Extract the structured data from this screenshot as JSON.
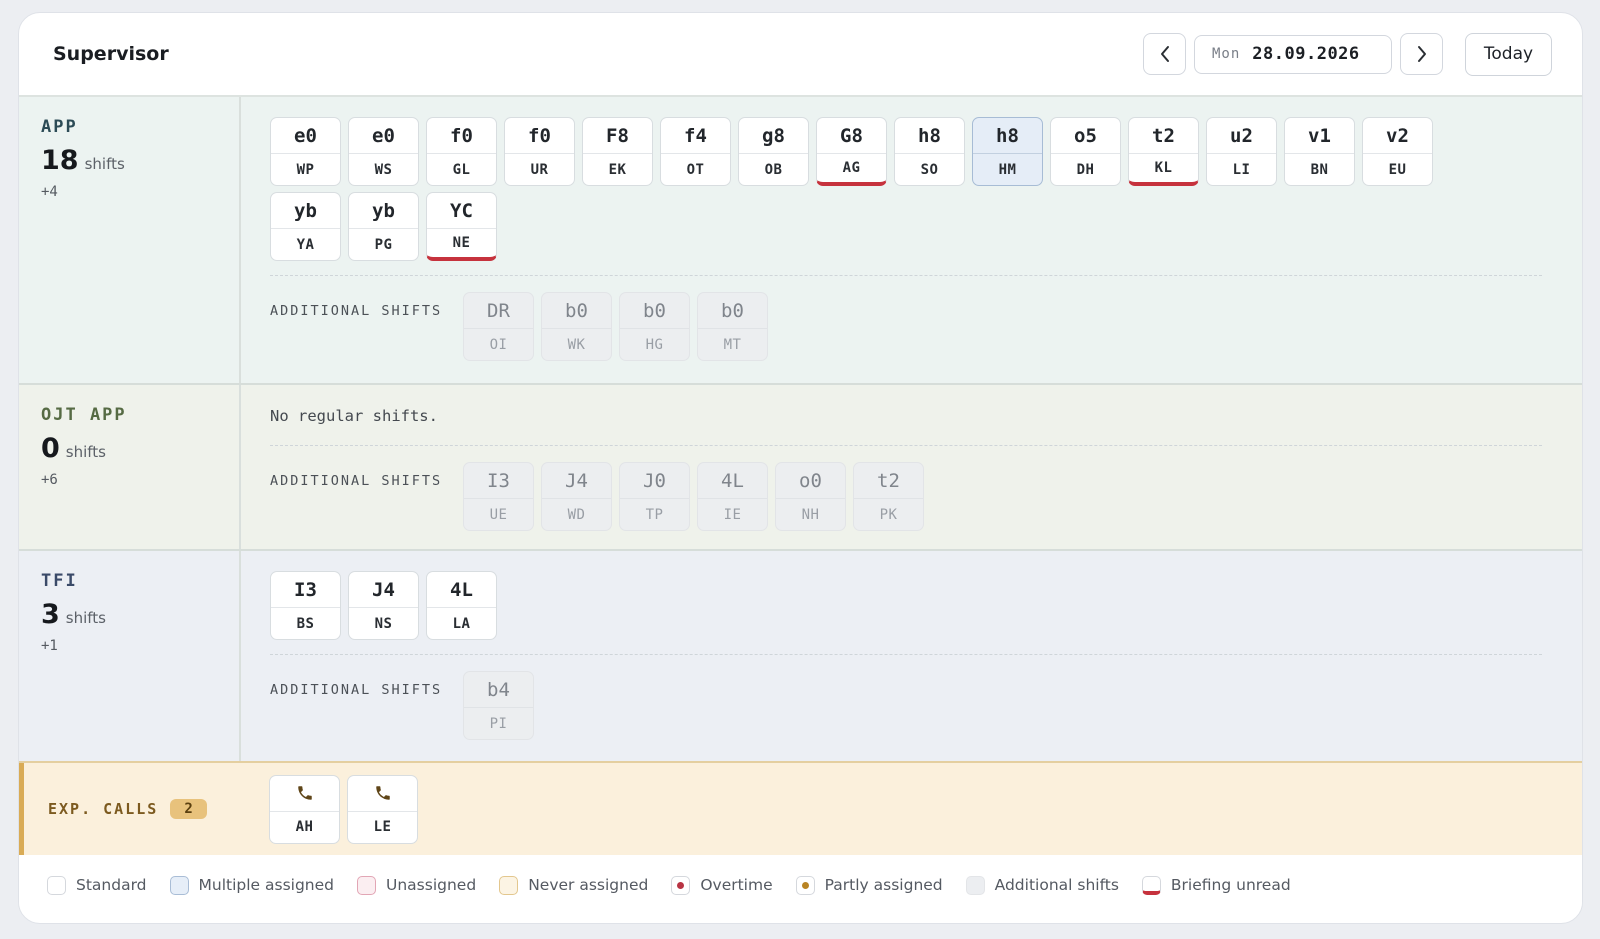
{
  "header": {
    "title": "Supervisor",
    "day": "Mon",
    "date": "28.09.2026",
    "today_label": "Today"
  },
  "sections": [
    {
      "name": "APP",
      "count": "18",
      "unit": "shifts",
      "plus": "+4",
      "empty_message": "",
      "shifts": [
        {
          "code": "e0",
          "who": "WP",
          "state": "standard"
        },
        {
          "code": "e0",
          "who": "WS",
          "state": "standard"
        },
        {
          "code": "f0",
          "who": "GL",
          "state": "standard"
        },
        {
          "code": "f0",
          "who": "UR",
          "state": "standard"
        },
        {
          "code": "F8",
          "who": "EK",
          "state": "standard"
        },
        {
          "code": "f4",
          "who": "OT",
          "state": "standard"
        },
        {
          "code": "g8",
          "who": "OB",
          "state": "standard"
        },
        {
          "code": "G8",
          "who": "AG",
          "state": "unread"
        },
        {
          "code": "h8",
          "who": "SO",
          "state": "standard"
        },
        {
          "code": "h8",
          "who": "HM",
          "state": "multi"
        },
        {
          "code": "o5",
          "who": "DH",
          "state": "standard"
        },
        {
          "code": "t2",
          "who": "KL",
          "state": "unread"
        },
        {
          "code": "u2",
          "who": "LI",
          "state": "standard"
        },
        {
          "code": "v1",
          "who": "BN",
          "state": "standard"
        },
        {
          "code": "v2",
          "who": "EU",
          "state": "standard"
        },
        {
          "code": "yb",
          "who": "YA",
          "state": "standard"
        },
        {
          "code": "yb",
          "who": "PG",
          "state": "standard"
        },
        {
          "code": "YC",
          "who": "NE",
          "state": "unread"
        }
      ],
      "additional_label": "ADDITIONAL SHIFTS",
      "additional": [
        {
          "code": "DR",
          "who": "OI"
        },
        {
          "code": "b0",
          "who": "WK"
        },
        {
          "code": "b0",
          "who": "HG"
        },
        {
          "code": "b0",
          "who": "MT"
        }
      ]
    },
    {
      "name": "OJT APP",
      "count": "0",
      "unit": "shifts",
      "plus": "+6",
      "empty_message": "No regular shifts.",
      "shifts": [],
      "additional_label": "ADDITIONAL SHIFTS",
      "additional": [
        {
          "code": "I3",
          "who": "UE"
        },
        {
          "code": "J4",
          "who": "WD"
        },
        {
          "code": "J0",
          "who": "TP"
        },
        {
          "code": "4L",
          "who": "IE"
        },
        {
          "code": "o0",
          "who": "NH"
        },
        {
          "code": "t2",
          "who": "PK"
        }
      ]
    },
    {
      "name": "TFI",
      "count": "3",
      "unit": "shifts",
      "plus": "+1",
      "empty_message": "",
      "shifts": [
        {
          "code": "I3",
          "who": "BS",
          "state": "standard"
        },
        {
          "code": "J4",
          "who": "NS",
          "state": "standard"
        },
        {
          "code": "4L",
          "who": "LA",
          "state": "standard"
        }
      ],
      "additional_label": "ADDITIONAL SHIFTS",
      "additional": [
        {
          "code": "b4",
          "who": "PI"
        }
      ]
    }
  ],
  "exp_calls": {
    "label": "EXP. CALLS",
    "count": "2",
    "calls": [
      {
        "icon": "phone-icon",
        "who": "AH"
      },
      {
        "icon": "phone-icon",
        "who": "LE"
      }
    ]
  },
  "legend": [
    {
      "key": "standard",
      "label": "Standard"
    },
    {
      "key": "multi",
      "label": "Multiple assigned"
    },
    {
      "key": "unas",
      "label": "Unassigned"
    },
    {
      "key": "never",
      "label": "Never assigned"
    },
    {
      "key": "ot",
      "label": "Overtime"
    },
    {
      "key": "pa",
      "label": "Partly assigned"
    },
    {
      "key": "add",
      "label": "Additional shifts"
    },
    {
      "key": "brief",
      "label": "Briefing unread"
    }
  ],
  "colors": {
    "briefing_unread": "#c6323d",
    "multi_assigned": "#a7bcd5",
    "exp_accent": "#d9ab55"
  }
}
